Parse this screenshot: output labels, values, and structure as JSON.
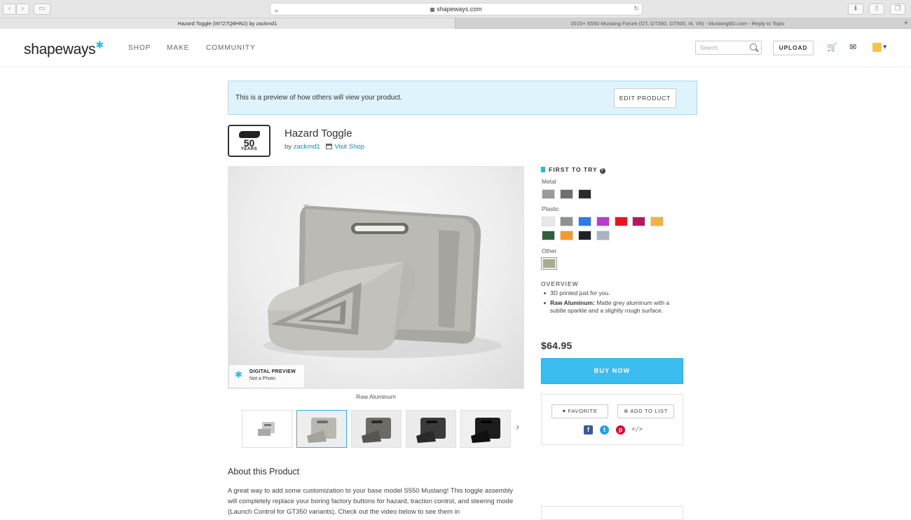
{
  "browser": {
    "url": "shapeways.com",
    "tabs": [
      {
        "label": "Hazard Toggle (W727Q8HN2) by zackmd1"
      },
      {
        "label": "2015+ S550 Mustang Forum (GT, GT350, GT500, I4, V6) - Mustang6G.com - Reply to Topic"
      }
    ],
    "back_icon": "chevron-left-icon",
    "forward_icon": "chevron-right-icon"
  },
  "header": {
    "logo": "shapeways",
    "nav": [
      "SHOP",
      "MAKE",
      "COMMUNITY"
    ],
    "search_placeholder": "Search",
    "upload_label": "UPLOAD"
  },
  "banner": {
    "text": "This is a preview of how others will view your product.",
    "edit_label": "EDIT PRODUCT"
  },
  "shop_logo": {
    "number": "50",
    "word": "YEARS"
  },
  "product": {
    "title": "Hazard Toggle",
    "by": "by",
    "author": "zackmd1",
    "visit_shop": "Visit Shop",
    "badge_title": "DIGITAL PREVIEW",
    "badge_sub": "Not a Photo",
    "caption": "Raw Aluminum",
    "price": "$64.95",
    "buy_label": "BUY NOW"
  },
  "materials": {
    "heading": "FIRST TO TRY",
    "help": "?",
    "groups": [
      {
        "label": "Metal",
        "swatches": [
          "#9a9a9a",
          "#6f6f6f",
          "#2b2b2b"
        ]
      },
      {
        "label": "Plastic",
        "swatches": [
          "#e8e8e8",
          "#8e9195",
          "#2f7ae5",
          "#b43fc9",
          "#e8141e",
          "#b8195a",
          "#f2b33d",
          "#2f5e3a",
          "#f29a2e",
          "#202124",
          "#a9b4c2"
        ]
      },
      {
        "label": "Other",
        "swatches": [
          "#a7ad8e"
        ]
      }
    ]
  },
  "overview": {
    "title": "OVERVIEW",
    "items": [
      {
        "bold": "",
        "text": "3D printed just for you."
      },
      {
        "bold": "Raw Aluminum:",
        "text": " Matte grey aluminum with a subtle sparkle and a slightly rough surface."
      }
    ]
  },
  "actions": {
    "favorite": "FAVORITE",
    "add_to_list": "ADD TO LIST"
  },
  "about": {
    "title": "About this Product",
    "text": "A great way to add some customization to your base model S550 Mustang! This toggle assembly will completely replace your boring factory buttons for hazard, traction control, and steering mode (Launch Control for GT350 variants). Check out the video below to see them in"
  }
}
